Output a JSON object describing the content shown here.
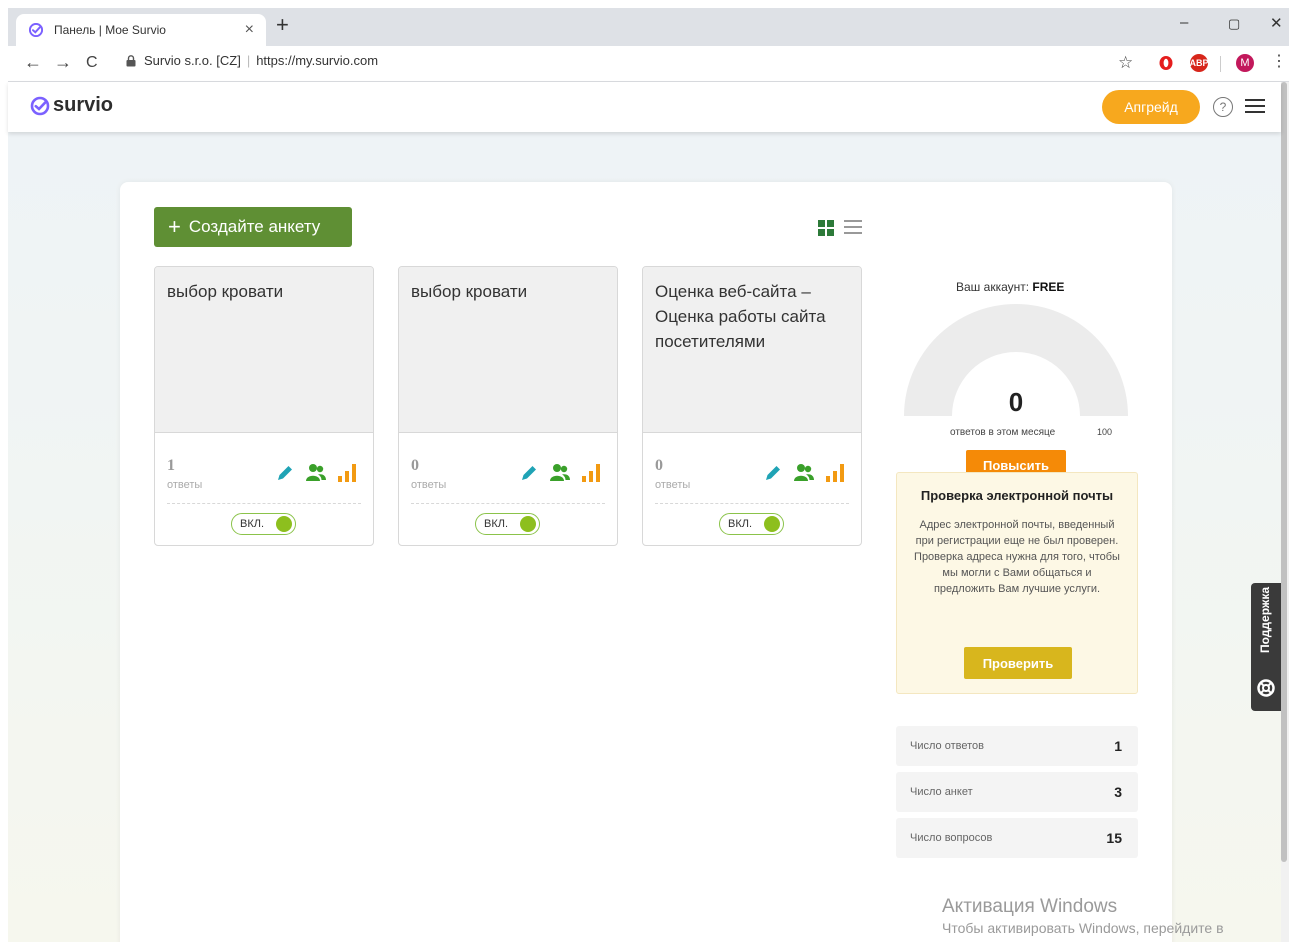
{
  "browser": {
    "tab_title": "Панель | Moe Survio",
    "tab_close": "×",
    "new_tab": "+",
    "window_controls": [
      "–",
      "▢",
      "✕"
    ],
    "site_identity": "Survio s.r.o. [CZ]",
    "url": "https://my.survio.com",
    "star": "☆",
    "nav_back": "←",
    "nav_forward": "→",
    "nav_reload": "C",
    "lock": "🔒",
    "ext_abp": "ABP",
    "profile_initial": "M",
    "menu_dots": "⋮"
  },
  "header": {
    "logo_text": "survio",
    "upgrade_label": "Апгрейд",
    "help_label": "?"
  },
  "toolbar": {
    "create_plus": "+",
    "create_label": "Создайте анкету"
  },
  "surveys": [
    {
      "title": "выбор кровати",
      "responses": "1",
      "responses_label": "ответы",
      "toggle_label": "ВКЛ."
    },
    {
      "title": "выбор кровати",
      "responses": "0",
      "responses_label": "ответы",
      "toggle_label": "ВКЛ."
    },
    {
      "title": "Оценка веб-сайта – Оценка работы сайта посетителями",
      "responses": "0",
      "responses_label": "ответы",
      "toggle_label": "ВКЛ."
    }
  ],
  "account": {
    "label": "Ваш аккаунт:",
    "plan": "FREE",
    "responses_this_month": "0",
    "gauge_fraction": 0,
    "gauge_caption": "ответов в этом месяце",
    "gauge_max": "100",
    "boost_label": "Повысить"
  },
  "verify": {
    "title": "Проверка электронной почты",
    "text": "Адрес электронной почты, введенный при регистрации еще не был проверен. Проверка адреса нужна для того, чтобы мы могли с Вами общаться и предложить Вам лучшие услуги.",
    "button_label": "Проверить"
  },
  "stats": [
    {
      "label": "Число ответов",
      "value": "1"
    },
    {
      "label": "Число анкет",
      "value": "3"
    },
    {
      "label": "Число вопросов",
      "value": "15"
    }
  ],
  "support": {
    "label": "Поддержка"
  },
  "watermark": {
    "title": "Активация Windows",
    "subtitle": "Чтобы активировать Windows, перейдите в"
  },
  "colors": {
    "brand_green": "#5f8f34",
    "upgrade_orange": "#f7a81e",
    "boost_orange": "#f58a07",
    "verify_yellow": "#d8b61d",
    "toggle_green": "#8dbf1e",
    "edit_icon": "#1fa3b5",
    "people_icon": "#3aa02a",
    "stats_icon": "#f29a12"
  },
  "icons": [
    "survio-check-icon",
    "lock-icon",
    "star-icon",
    "opera-icon",
    "abp-icon",
    "profile-icon",
    "help-icon",
    "hamburger-menu-icon",
    "grid-view-icon",
    "list-view-icon",
    "pencil-icon",
    "people-icon",
    "bar-chart-icon",
    "lifebuoy-icon"
  ]
}
